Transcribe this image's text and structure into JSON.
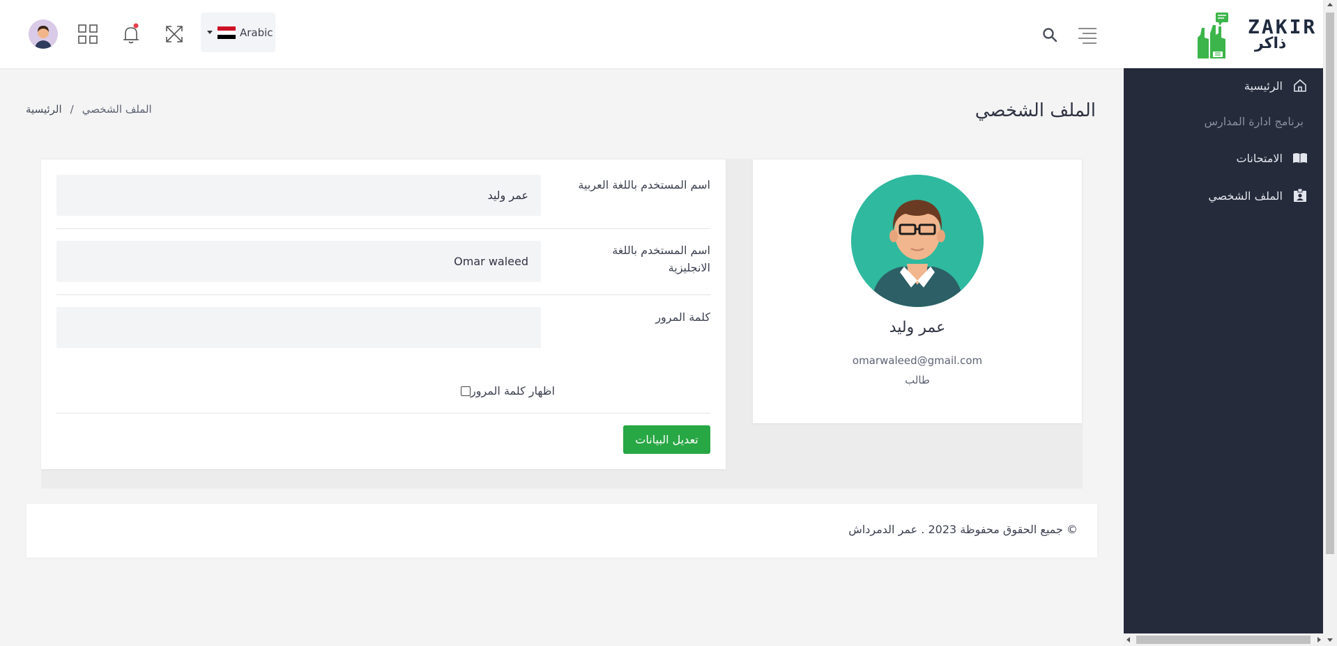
{
  "header": {
    "language": "Arabic",
    "flag_colors": [
      "#ce1126",
      "#ffffff",
      "#000000"
    ],
    "notification_badge_color": "#e7414a"
  },
  "logo": {
    "text_en": "ZAKIR",
    "text_ar": "ذاكر",
    "accent_color": "#3cb54a"
  },
  "sidebar": {
    "items": [
      {
        "label": "الرئيسية",
        "icon": "home-icon"
      },
      {
        "label": "الامتحانات",
        "icon": "book-icon"
      },
      {
        "label": "الملف الشخصي",
        "icon": "id-badge-icon"
      }
    ],
    "section_label": "برنامج ادارة المدارس",
    "background": "#252b3b"
  },
  "page": {
    "title": "الملف الشخصي",
    "breadcrumb": {
      "home": "الرئيسية",
      "separator": "/",
      "current": "الملف الشخصي"
    }
  },
  "profile": {
    "name": "عمر وليد",
    "email": "omarwaleed@gmail.com",
    "role": "طالب"
  },
  "form": {
    "arabic_name_label": "اسم المستخدم باللغة العربية",
    "arabic_name_value": "عمر وليد",
    "english_name_label": "اسم المستخدم باللغة الانجليزية",
    "english_name_value": "Omar waleed",
    "password_label": "كلمة المرور",
    "password_value": "",
    "show_password_label": "اظهار كلمة المرور",
    "show_password_checked": false,
    "save_button": "تعديل البيانات",
    "save_button_color": "#28a745"
  },
  "footer": {
    "text": "© جميع الحقوق محفوظة 2023 . عمر الدمرداش"
  }
}
